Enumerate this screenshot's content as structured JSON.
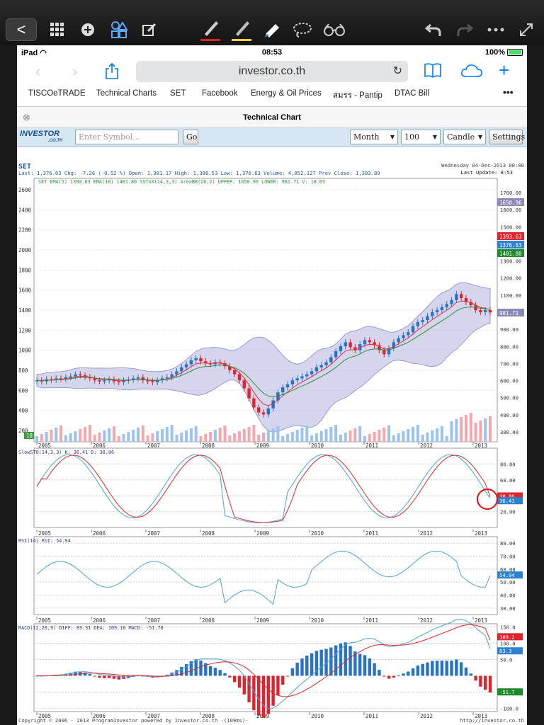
{
  "toolbar": {
    "back_label": "<"
  },
  "status": {
    "device": "iPad",
    "time": "08:53",
    "battery": "100%"
  },
  "browser": {
    "url": "investor.co.th"
  },
  "bookmarks": [
    "TISCOeTRADE",
    "Technical Charts",
    "SET",
    "Facebook",
    "Energy & Oil Prices",
    "สมรร - Pantip",
    "DTAC Bill",
    "•••"
  ],
  "page": {
    "title": "Technical Chart"
  },
  "controls": {
    "symbol_placeholder": "Enter Symbol...",
    "go": "Go",
    "period": "Month",
    "bars": "100",
    "style": "Candle",
    "settings": "Settings"
  },
  "quote": {
    "symbol": "SET",
    "last_line": "Last: 1,376.63  Chg: -7.26 (-0.52 %)  Open: 1,381.17  High: 1,388.53  Low: 1,376.63  Volume: 4,852,127  Prev Close: 1,383.89",
    "date": "Wednesday 04-Dec-2013 00:00",
    "update": "Last Update: 8:53"
  },
  "legend_main": "SET  EMA(5) 1393.63  EMA(10) 1401.80  SSToX(14,3,3)  AreaBB(26,2)  UPPER: 1650.96  LOWER: 981.71  V: 18.05",
  "legend_sto": "SlowSTO(14,3,3)  K: 36.41  D: 38.86",
  "legend_rsi": "RSI(14)  RSI: 54.94",
  "legend_macd": "MACD(12,26,9)  DIFF: 83.31  DEA: 109.16  MACD: -51.70",
  "footer_left": "Copyright © 2006 - 2013 ProgramInvestor powered by Investor.co.th -(109ms)-",
  "footer_right": "http://investor.co.th",
  "colors": {
    "bull": "#2a72c6",
    "bear": "#e0242e",
    "band": "#b9b9e3",
    "ema5": "#e03040",
    "ema10": "#2f8f3a",
    "k": "#4aa2e6",
    "d": "#e02828"
  },
  "chart_data": [
    {
      "type": "line",
      "title": "SET",
      "x": [
        "2005",
        "2006",
        "2007",
        "2008",
        "2009",
        "2010",
        "2011",
        "2012",
        "2013"
      ],
      "left_axis_ticks": [
        200,
        400,
        600,
        800,
        1000,
        1200,
        1400,
        1600,
        1800,
        2000,
        2200,
        2400,
        2600
      ],
      "right_axis_ticks": [
        300,
        400,
        500,
        600,
        700,
        800,
        900,
        1000,
        1100,
        1200,
        1300,
        1400,
        1500,
        1600,
        1700
      ],
      "right_axis_tick_labels": [
        "300.00",
        "400.00",
        "500.00",
        "600.00",
        "700.00",
        "800.00",
        "900.00",
        "1000.00",
        "1100.00",
        "1200.00",
        "1300.00",
        "1400.00",
        "1500.00",
        "1600.00",
        "1700.00"
      ],
      "close": [
        700,
        690,
        710,
        705,
        720,
        715,
        730,
        740,
        760,
        750,
        735,
        720,
        700,
        690,
        700,
        710,
        690,
        680,
        700,
        705,
        720,
        730,
        700,
        690,
        680,
        700,
        720,
        730,
        760,
        790,
        830,
        860,
        900,
        920,
        890,
        870,
        860,
        880,
        870,
        840,
        800,
        760,
        700,
        620,
        520,
        430,
        380,
        360,
        420,
        500,
        580,
        630,
        660,
        700,
        720,
        740,
        760,
        790,
        830,
        850,
        880,
        930,
        990,
        1040,
        1080,
        1030,
        1000,
        1060,
        1100,
        1080,
        1050,
        1000,
        960,
        1020,
        1080,
        1120,
        1150,
        1180,
        1240,
        1280,
        1300,
        1340,
        1380,
        1400,
        1430,
        1460,
        1500,
        1560,
        1520,
        1480,
        1450,
        1400,
        1380,
        1400,
        1376.63
      ],
      "series": [
        {
          "name": "EMA(5)",
          "last": 1393.63
        },
        {
          "name": "EMA(10)",
          "last": 1401.8
        },
        {
          "name": "UPPER",
          "last": 1650.96
        },
        {
          "name": "LOWER",
          "last": 981.71
        }
      ],
      "price_labels": [
        "1650.96",
        "1393.63",
        "1376.63",
        "1401.80",
        "981.71"
      ],
      "volume_badge": "18"
    },
    {
      "type": "line",
      "title": "SlowSTO(14,3,3)",
      "axis_ticks": [
        "20.00",
        "40.00",
        "60.00",
        "80.00"
      ],
      "series": [
        {
          "name": "K",
          "last": 36.41,
          "last_label": "36.41"
        },
        {
          "name": "D",
          "last": 38.86,
          "last_label": "38.86"
        }
      ],
      "ylim": [
        0,
        100
      ]
    },
    {
      "type": "line",
      "title": "RSI(14)",
      "axis_ticks": [
        "30.00",
        "40.00",
        "50.00",
        "60.00",
        "70.00",
        "80.00"
      ],
      "series": [
        {
          "name": "RSI",
          "last": 54.94,
          "last_label": "54.94"
        }
      ],
      "ylim": [
        25,
        85
      ]
    },
    {
      "type": "bar",
      "title": "MACD(12,26,9)",
      "axis_ticks": [
        "-100.0",
        "-50.0",
        "50.0",
        "100.0",
        "150.0"
      ],
      "series": [
        {
          "name": "DIFF",
          "last": 83.31,
          "last_label": "83.3"
        },
        {
          "name": "DEA",
          "last": 109.16,
          "last_label": "109.2"
        },
        {
          "name": "MACD",
          "last": -51.7,
          "last_label": "-51.7"
        }
      ],
      "ylim": [
        -110,
        160
      ]
    }
  ]
}
